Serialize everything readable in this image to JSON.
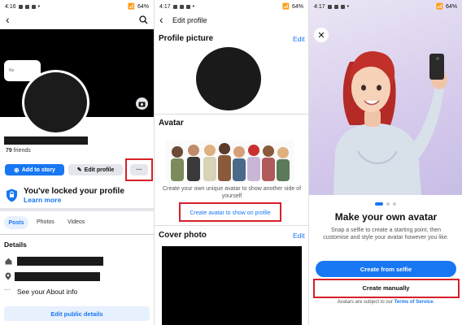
{
  "panel1": {
    "status": {
      "time": "4:16",
      "battery": "64%"
    },
    "friends_count": "79",
    "friends_label": "friends",
    "add_story_label": "Add to story",
    "edit_profile_label": "Edit profile",
    "more_label": "···",
    "locked_title": "You've locked your profile",
    "learn_more": "Learn more",
    "tabs": [
      "Posts",
      "Photos",
      "Videos"
    ],
    "details_heading": "Details",
    "see_about": "See your About info",
    "edit_public_details": "Edit public details",
    "cover_tag": "No"
  },
  "panel2": {
    "status": {
      "time": "4:17",
      "battery": "64%"
    },
    "title": "Edit profile",
    "profile_picture_heading": "Profile picture",
    "edit_link": "Edit",
    "avatar_heading": "Avatar",
    "avatar_caption": "Create your own unique avatar to show another side of yourself",
    "create_avatar_button": "Create avatar to show on profile",
    "cover_photo_heading": "Cover photo",
    "cover_edit_link": "Edit"
  },
  "panel3": {
    "status": {
      "time": "4:17",
      "battery": "64%"
    },
    "heading": "Make your own avatar",
    "description": "Snap a selfie to create a starting point, then customise and style your avatar however you like.",
    "create_selfie_button": "Create from selfie",
    "create_manual_button": "Create manually",
    "terms_prefix": "Avatars are subject to our",
    "terms_link": "Terms of Service",
    "terms_suffix": "."
  },
  "colors": {
    "accent": "#1877f2",
    "highlight": "#d6202a"
  }
}
